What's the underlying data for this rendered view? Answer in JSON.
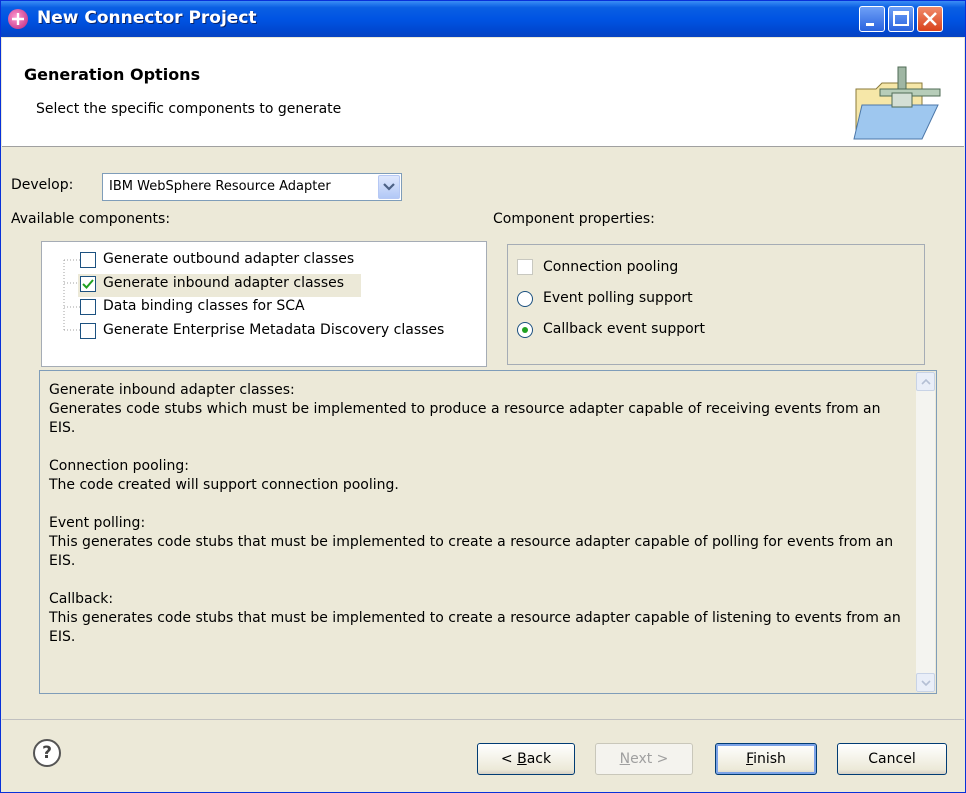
{
  "window": {
    "title": "New Connector Project"
  },
  "header": {
    "title": "Generation Options",
    "description": "Select the specific components to generate"
  },
  "develop": {
    "label": "Develop:",
    "selected": "IBM WebSphere Resource Adapter"
  },
  "available": {
    "label": "Available components:",
    "items": [
      {
        "label": "Generate outbound adapter classes",
        "checked": false
      },
      {
        "label": "Generate inbound adapter classes",
        "checked": true
      },
      {
        "label": "Data binding classes for SCA",
        "checked": false
      },
      {
        "label": "Generate Enterprise Metadata Discovery classes",
        "checked": false
      }
    ]
  },
  "properties": {
    "label": "Component properties:",
    "connection_pooling": {
      "label": "Connection pooling",
      "checked": false
    },
    "event_polling": {
      "label": "Event polling support",
      "selected": false
    },
    "callback_event": {
      "label": "Callback event support",
      "selected": true
    }
  },
  "description_text": "Generate inbound adapter classes:\nGenerates code stubs which must be implemented to produce a resource adapter capable of receiving events from an EIS.\n\nConnection pooling:\nThe code created will support connection pooling.\n\nEvent polling:\nThis generates code stubs that must be implemented to create a resource adapter capable of polling for events from an EIS.\n\nCallback:\nThis generates code stubs that must be implemented to create a resource adapter capable of listening to events from an EIS.",
  "buttons": {
    "back_prefix": "< ",
    "back_mnemonic": "B",
    "back_rest": "ack",
    "next_mnemonic": "N",
    "next_rest": "ext >",
    "finish_mnemonic": "F",
    "finish_rest": "inish",
    "cancel": "Cancel"
  },
  "help_symbol": "?",
  "colors": {
    "titlebar": "#0054e3",
    "dialog_bg": "#ece9d8",
    "check_green": "#21a121"
  },
  "icons": [
    "app-icon",
    "minimize-icon",
    "maximize-icon",
    "close-icon",
    "folder-connector-icon",
    "dropdown-arrow-icon",
    "checkmark-icon",
    "help-icon",
    "scroll-up-icon",
    "scroll-down-icon"
  ]
}
